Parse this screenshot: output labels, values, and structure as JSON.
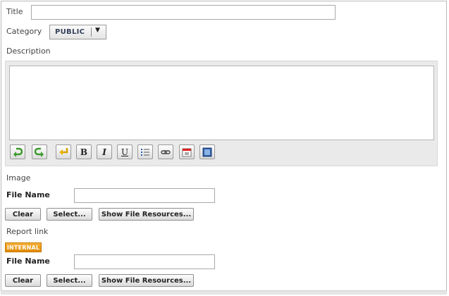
{
  "form": {
    "title_label": "Title",
    "title_value": "",
    "category_label": "Category",
    "category_value": "PUBLIC",
    "description_label": "Description",
    "description_value": ""
  },
  "editor_toolbar": {
    "icons": [
      "undo-icon",
      "redo-icon",
      "return-icon",
      "bold-icon",
      "italic-icon",
      "underline-icon",
      "bulleted-list-icon",
      "link-icon",
      "calendar-icon",
      "image-icon"
    ],
    "bold_glyph": "B",
    "italic_glyph": "I",
    "underline_glyph": "U"
  },
  "image_section": {
    "heading": "Image",
    "file_name_label": "File Name",
    "file_name_value": "",
    "clear_label": "Clear",
    "select_label": "Select...",
    "show_resources_label": "Show File Resources..."
  },
  "report_section": {
    "heading": "Report link",
    "badge": "INTERNAL",
    "file_name_label": "File Name",
    "file_name_value": "",
    "clear_label": "Clear",
    "select_label": "Select...",
    "show_resources_label": "Show File Resources..."
  },
  "colors": {
    "badge": "#e8950f",
    "undo_green": "#3a9a2a",
    "border": "#b9b9b9"
  }
}
